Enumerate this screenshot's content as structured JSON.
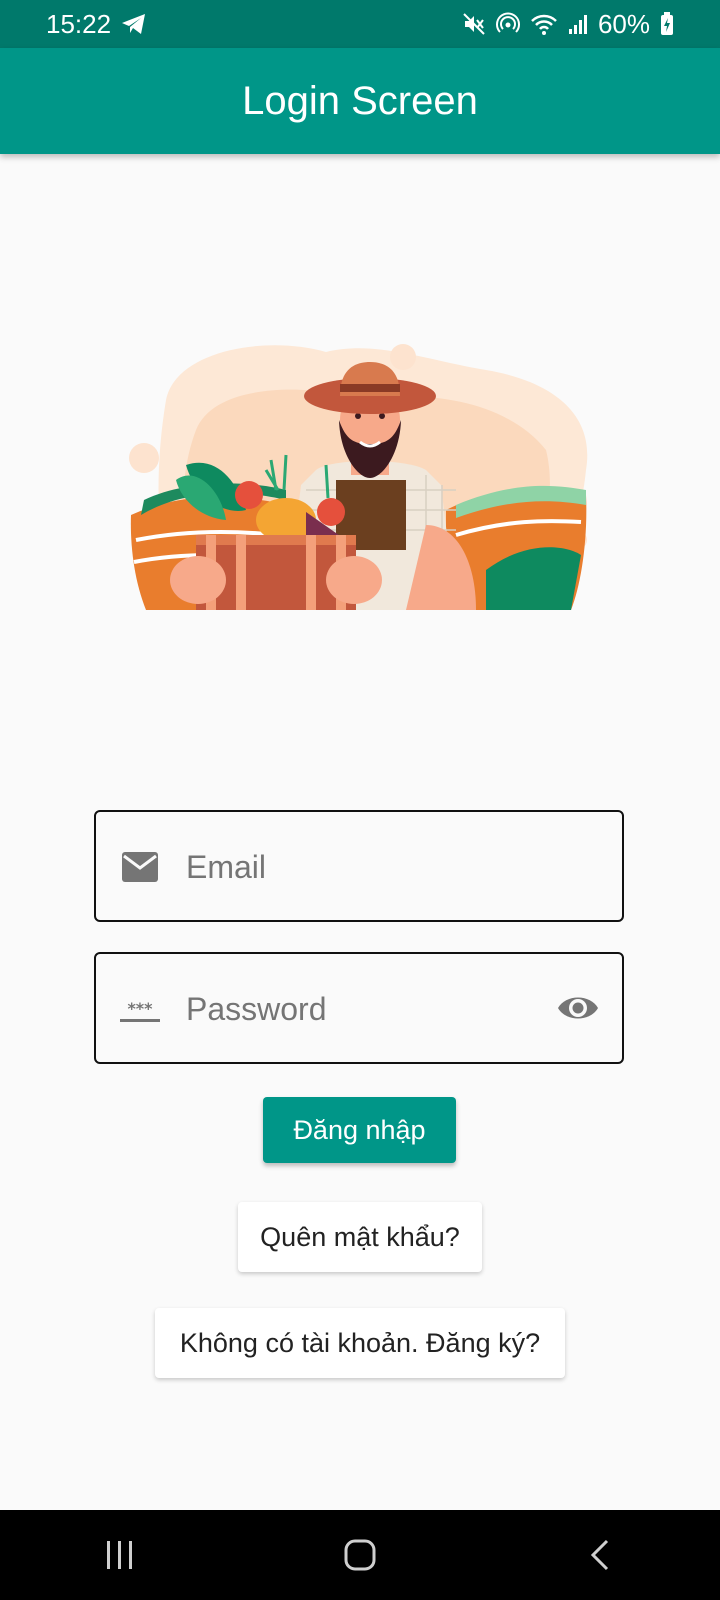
{
  "status_bar": {
    "time": "15:22",
    "battery": "60%"
  },
  "app_bar": {
    "title": "Login Screen"
  },
  "form": {
    "email": {
      "placeholder": "Email",
      "value": ""
    },
    "password": {
      "placeholder": "Password",
      "value": ""
    },
    "login_label": "Đăng nhập",
    "forgot_label": "Quên mật khẩu?",
    "register_label": "Không có tài khoản. Đăng ký?"
  },
  "icons": {
    "email": "mail-icon",
    "password": "password-icon",
    "visibility": "eye-icon"
  },
  "colors": {
    "primary": "#009688",
    "primary_dark": "#00796b"
  }
}
